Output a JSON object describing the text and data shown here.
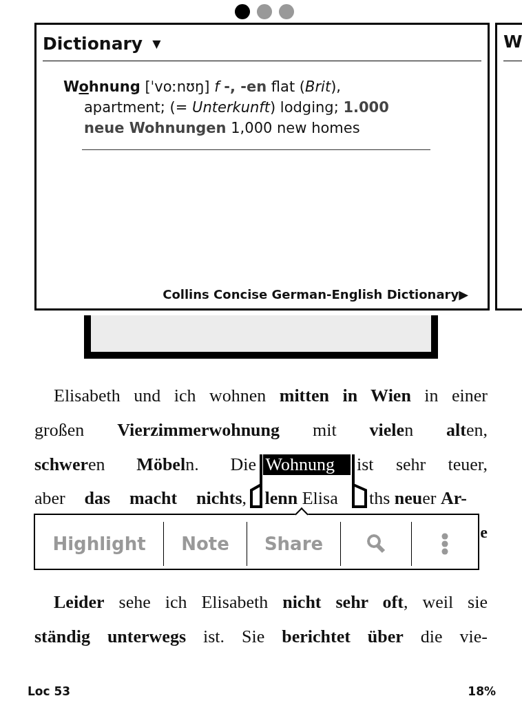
{
  "page_dots": [
    {
      "selected": true
    },
    {
      "selected": false
    },
    {
      "selected": false
    }
  ],
  "dictionary_popup": {
    "title": "Dictionary",
    "dropdown_icon": "▼",
    "headword": {
      "before": "W",
      "stressed": "o",
      "after": "hnung"
    },
    "definition": "[ˈvoːnʊŋ] *f* **-, -en** flat (*Brit*), apartment; (= *Unterkunft*) lodging; **1.000 neue Wohnungen** 1,000 new homes",
    "source": "Collins Concise German-English Dictionary",
    "source_arrow": "▶"
  },
  "next_card": {
    "title": "W"
  },
  "book_lines": [
    {
      "kind": "text",
      "indent": true,
      "bold": false,
      "text": "Elisabeth und ich wohnen **mitten in Wien** in einer"
    },
    {
      "kind": "text",
      "indent": false,
      "bold": false,
      "text": "großen **Vierzimmerwohnung** mit **viele**n **alt**en,"
    },
    {
      "kind": "selection",
      "before": "**schwer**en **Möbel**n. Die",
      "selected": "Wohnung",
      "after": "ist sehr teuer,"
    },
    {
      "kind": "split",
      "parts": [
        "aber **das macht nichts**,",
        "**lenn** Elisa",
        "ths **neu**er **Ar-**"
      ]
    },
    {
      "kind": "edge",
      "indent": false,
      "bold": true,
      "text": "e"
    },
    {
      "kind": "covered"
    },
    {
      "kind": "text",
      "indent": true,
      "bold": false,
      "text": "**Leider** sehe ich Elisabeth **nicht sehr oft**, weil sie"
    },
    {
      "kind": "text",
      "indent": false,
      "bold": false,
      "text": "**ständig unterwegs** ist. Sie **berichtet über** die vie-"
    }
  ],
  "toolbar": {
    "items": [
      {
        "kind": "label",
        "text": "Highlight"
      },
      {
        "kind": "label",
        "text": "Note"
      },
      {
        "kind": "label",
        "text": "Share"
      },
      {
        "kind": "search"
      },
      {
        "kind": "more"
      }
    ]
  },
  "status_bar": {
    "location": "Loc 53",
    "progress": "18%"
  }
}
